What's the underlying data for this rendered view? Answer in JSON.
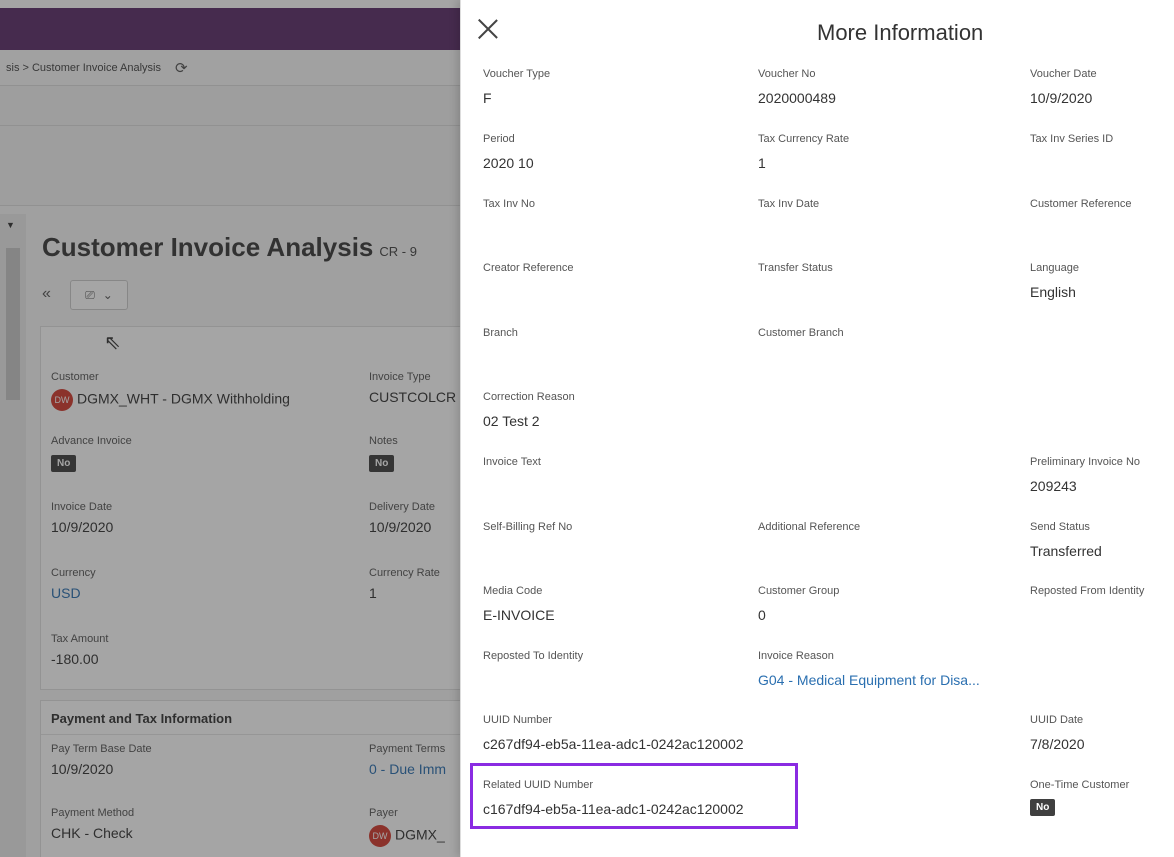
{
  "background": {
    "breadcrumb": "sis > Customer Invoice Analysis",
    "page_title": "Customer Invoice Analysis",
    "page_code": "CR - 9",
    "collapse_glyph": "«",
    "action_icon_glyph": "⎚",
    "action_chevron": "⌄",
    "header_card": {
      "customer_label": "Customer",
      "customer_avatar": "DW",
      "customer_value": "DGMX_WHT - DGMX Withholding",
      "invoice_type_label": "Invoice Type",
      "invoice_type_value": "CUSTCOLCR",
      "advance_invoice_label": "Advance Invoice",
      "advance_invoice_value": "No",
      "notes_label": "Notes",
      "notes_value": "No",
      "invoice_date_label": "Invoice Date",
      "invoice_date_value": "10/9/2020",
      "delivery_date_label": "Delivery Date",
      "delivery_date_value": "10/9/2020",
      "currency_label": "Currency",
      "currency_value": "USD",
      "currency_rate_label": "Currency Rate",
      "currency_rate_value": "1",
      "tax_amount_label": "Tax Amount",
      "tax_amount_value": "-180.00"
    },
    "payment_card": {
      "title": "Payment and Tax Information",
      "pay_term_base_date_label": "Pay Term Base Date",
      "pay_term_base_date_value": "10/9/2020",
      "payment_terms_label": "Payment Terms",
      "payment_terms_value": "0 - Due Imm",
      "payment_method_label": "Payment Method",
      "payment_method_value": "CHK - Check",
      "payer_label": "Payer",
      "payer_avatar": "DW",
      "payer_value": "DGMX_"
    }
  },
  "panel": {
    "title": "More Information",
    "fields": {
      "voucher_type": {
        "label": "Voucher Type",
        "value": "F"
      },
      "voucher_no": {
        "label": "Voucher No",
        "value": "2020000489"
      },
      "voucher_date": {
        "label": "Voucher Date",
        "value": "10/9/2020"
      },
      "period": {
        "label": "Period",
        "value": "2020 10"
      },
      "tax_currency_rate": {
        "label": "Tax Currency Rate",
        "value": "1"
      },
      "tax_inv_series_id": {
        "label": "Tax Inv Series ID",
        "value": ""
      },
      "tax_inv_no": {
        "label": "Tax Inv No",
        "value": ""
      },
      "tax_inv_date": {
        "label": "Tax Inv Date",
        "value": ""
      },
      "customer_reference": {
        "label": "Customer Reference",
        "value": ""
      },
      "creator_reference": {
        "label": "Creator Reference",
        "value": ""
      },
      "transfer_status": {
        "label": "Transfer Status",
        "value": ""
      },
      "language": {
        "label": "Language",
        "value": "English"
      },
      "branch": {
        "label": "Branch",
        "value": ""
      },
      "customer_branch": {
        "label": "Customer Branch",
        "value": ""
      },
      "correction_reason": {
        "label": "Correction Reason",
        "value": "02 Test 2"
      },
      "invoice_text": {
        "label": "Invoice Text",
        "value": ""
      },
      "preliminary_invoice_no": {
        "label": "Preliminary Invoice No",
        "value": "209243"
      },
      "self_billing_ref_no": {
        "label": "Self-Billing Ref No",
        "value": ""
      },
      "additional_reference": {
        "label": "Additional Reference",
        "value": ""
      },
      "send_status": {
        "label": "Send Status",
        "value": "Transferred"
      },
      "media_code": {
        "label": "Media Code",
        "value": "E-INVOICE"
      },
      "customer_group": {
        "label": "Customer Group",
        "value": "0"
      },
      "reposted_from_identity": {
        "label": "Reposted From Identity",
        "value": ""
      },
      "reposted_to_identity": {
        "label": "Reposted To Identity",
        "value": ""
      },
      "invoice_reason": {
        "label": "Invoice Reason",
        "value": "G04 - Medical Equipment for Disa..."
      },
      "uuid_number": {
        "label": "UUID Number",
        "value": "c267df94-eb5a-11ea-adc1-0242ac120002"
      },
      "uuid_date": {
        "label": "UUID Date",
        "value": "7/8/2020"
      },
      "related_uuid_number": {
        "label": "Related UUID Number",
        "value": "c167df94-eb5a-11ea-adc1-0242ac120002"
      },
      "one_time_customer": {
        "label": "One-Time Customer",
        "value": "No"
      }
    }
  },
  "colors": {
    "brand_bar": "#5c2d6a",
    "link": "#2a6fb0",
    "highlight": "#8a2be2",
    "avatar": "#d23a2e"
  }
}
